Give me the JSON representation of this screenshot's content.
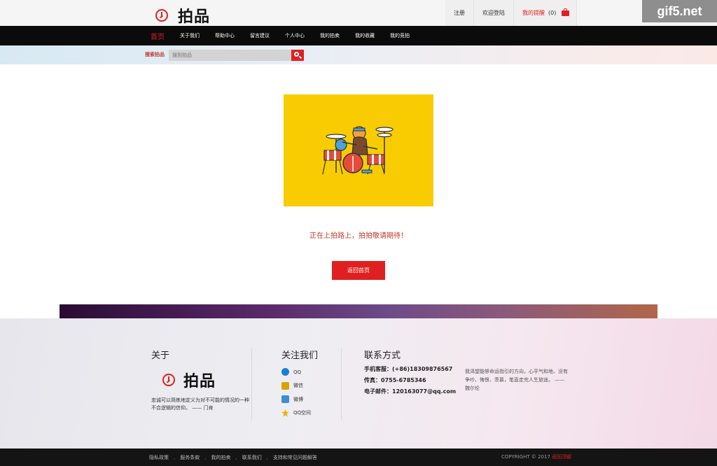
{
  "header": {
    "brand_name": "拍品",
    "links": {
      "register": "注册",
      "login": "欢迎登陆",
      "cart": "我的提醒",
      "cart_count": "(0)"
    },
    "watermark": "gif5.net"
  },
  "nav": {
    "items": [
      {
        "label": "首页",
        "active": true
      },
      {
        "label": "关于我们"
      },
      {
        "label": "帮助中心"
      },
      {
        "label": "留言建议"
      },
      {
        "label": "个人中心"
      },
      {
        "label": "我的拍卖"
      },
      {
        "label": "我的收藏"
      },
      {
        "label": "我的竞拍"
      }
    ]
  },
  "search": {
    "label": "搜索拍品",
    "placeholder": "搜到拍品"
  },
  "main": {
    "message": "正在上拍路上，拍拍敬请期待！",
    "back_button": "返回首页"
  },
  "footer": {
    "about": {
      "title": "关于",
      "brand_name": "拍品",
      "text": "忠诚可以简练地定义为对不可能的情况的一种不合逻辑的信仰。 —— 门肯"
    },
    "follow": {
      "title": "关注我们",
      "items": [
        {
          "label": "QQ",
          "icon": "qq-icon",
          "color": "#1a7fd4"
        },
        {
          "label": "微信",
          "icon": "wechat-icon",
          "color": "#d9a400"
        },
        {
          "label": "微博",
          "icon": "weibo-icon",
          "color": "#3a8fd0"
        },
        {
          "label": "QQ空间",
          "icon": "qzone-icon",
          "color": "#e8b400"
        }
      ]
    },
    "contact": {
      "title": "联系方式",
      "items": [
        "手机客服：(+86)18309876567",
        "传真：0755-6785346",
        "电子邮件：120163077@qq.com"
      ],
      "quote": "我渴望能够命运指引的方向，心平气和地、没有争吵、悔恨、羡慕，笔直走完人生旅途。 —— 魏尔伦"
    }
  },
  "bottom": {
    "links": [
      "隐私政策",
      "服务条款",
      "我的拍卖",
      "联系我们",
      "支持和常见问题解答"
    ],
    "copyright_prefix": "COPYRIGHT © 2017 ",
    "copyright_highlight": "返回顶部"
  },
  "colors": {
    "accent": "#e02020",
    "illustration_bg": "#f8cc00",
    "nav_bg": "#0b0b0b"
  }
}
